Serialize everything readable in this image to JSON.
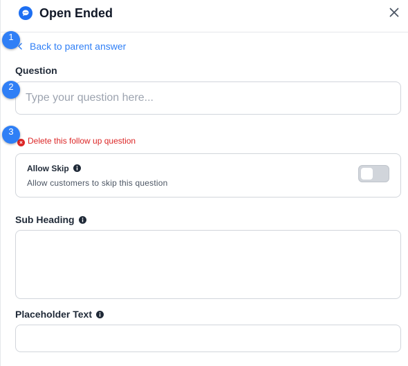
{
  "header": {
    "title": "Open Ended",
    "icon": "chat-bubble-icon",
    "close_icon": "close-icon"
  },
  "steps": [
    "1",
    "2",
    "3"
  ],
  "back_link": {
    "label": "Back to parent answer",
    "icon": "chevron-left-icon"
  },
  "question": {
    "label": "Question",
    "placeholder": "Type your question here...",
    "value": ""
  },
  "delete_link": {
    "label": "Delete this follow up question",
    "icon": "delete-circle-icon"
  },
  "allow_skip": {
    "title": "Allow Skip",
    "description": "Allow customers to skip this question",
    "enabled": false,
    "info_icon": "info-icon"
  },
  "sub_heading": {
    "label": "Sub Heading",
    "value": "",
    "info_icon": "info-icon"
  },
  "placeholder_text": {
    "label": "Placeholder Text",
    "value": "",
    "info_icon": "info-icon"
  },
  "colors": {
    "accent": "#2f7ff6",
    "danger": "#dc2626",
    "border": "#d1d5db",
    "toggle_off": "#d1d5db"
  }
}
